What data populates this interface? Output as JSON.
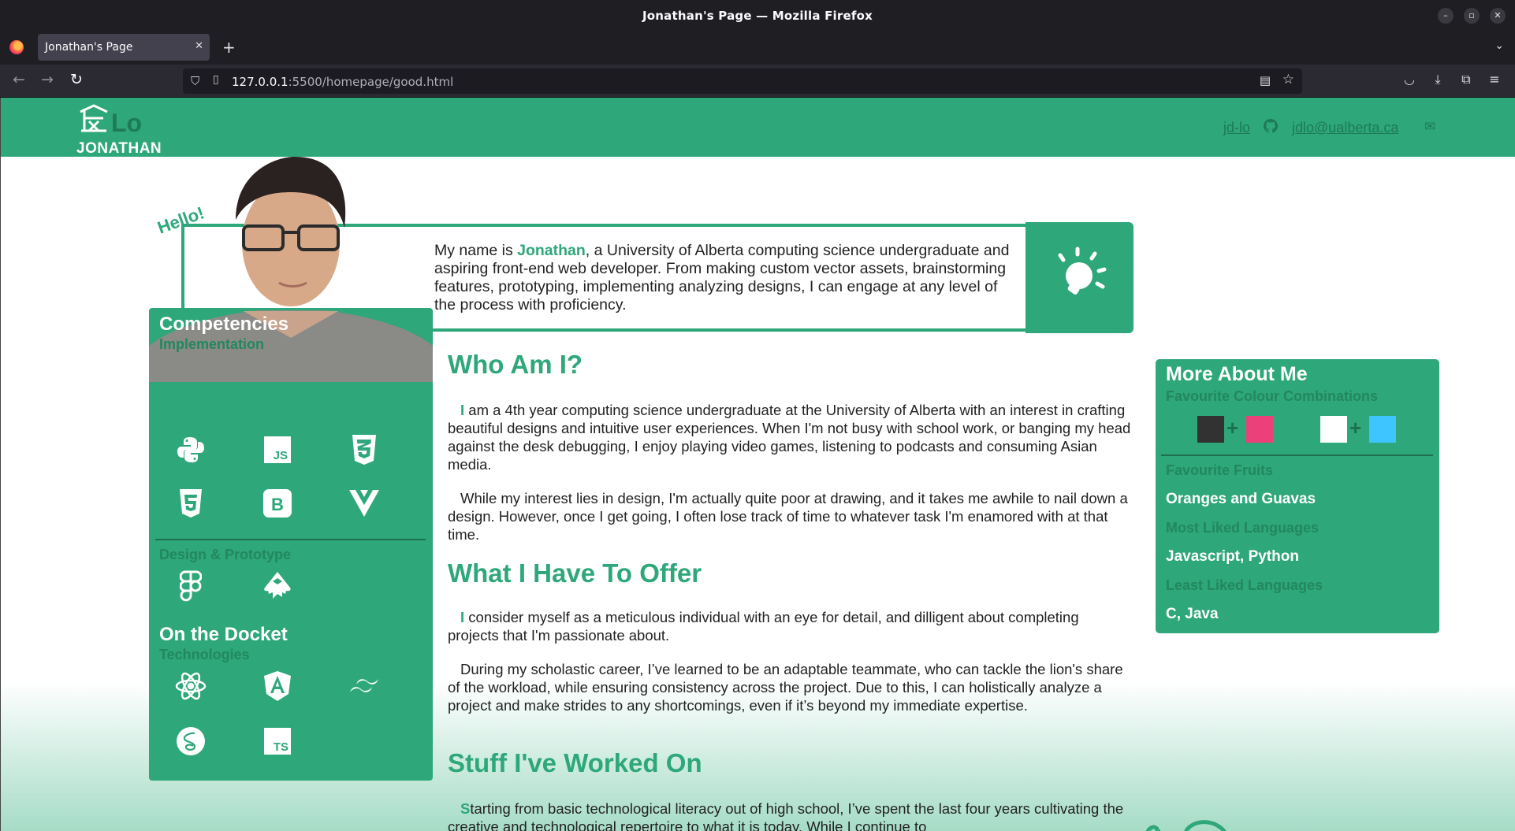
{
  "window": {
    "title": "Jonathan's Page — Mozilla Firefox"
  },
  "tab": {
    "title": "Jonathan's Page"
  },
  "urlbar": {
    "host": "127.0.0.1",
    "rest": ":5500/homepage/good.html"
  },
  "header": {
    "logo_text": "Lo",
    "logo_name": "JONATHAN",
    "github_label": "jd-lo",
    "email_label": "jdlo@ualberta.ca"
  },
  "intro": {
    "hello": "Hello!",
    "prefix": "My name is ",
    "name": "Jonathan",
    "rest": ", a University of Alberta computing science undergraduate and aspiring front-end web developer. From making custom vector assets, brainstorming features, prototyping, implementing analyzing designs, I can engage at any level of the process with proficiency."
  },
  "sidebar": {
    "competencies_title": "Competencies",
    "implementation_label": "Implementation",
    "implementation_icons": [
      "python-icon",
      "javascript-icon",
      "css3-icon",
      "html5-icon",
      "bootstrap-icon",
      "vue-icon"
    ],
    "design_label": "Design & Prototype",
    "design_icons": [
      "figma-icon",
      "inkscape-icon"
    ],
    "docket_title": "On the Docket",
    "technologies_label": "Technologies",
    "technologies_icons": [
      "react-icon",
      "angular-icon",
      "tailwind-icon",
      "sass-icon",
      "typescript-icon"
    ]
  },
  "main": {
    "who_title": "Who Am I?",
    "who_p1_first": "I",
    "who_p1_rest": " am a 4th year computing science undergraduate at the University of Alberta with an interest in crafting beautiful designs and intuitive user experiences. When I'm not busy with school work, or banging my head against the desk debugging, I enjoy playing video games, listening to podcasts and consuming Asian media.",
    "who_p2": "While my interest lies in design, I'm actually quite poor at drawing, and it takes me awhile to nail down a design. However, once I get going, I often lose track of time to whatever task I'm enamored with at that time.",
    "offer_title": "What I Have To Offer",
    "offer_p1_first": "I",
    "offer_p1_rest": " consider myself as a meticulous individual with an eye for detail, and dilligent about completing projects that I'm passionate about.",
    "offer_p2": "During my scholastic career, I’ve learned to be an adaptable teammate, who can tackle the lion's share of the workload, while ensuring consistency across the project. Due to this, I can holistically analyze a project and make strides to any shortcomings, even if it’s beyond my immediate expertise.",
    "stuff_title": "Stuff I've Worked On",
    "stuff_p1_first": "S",
    "stuff_p1_rest": "tarting from basic technological literacy out of high school, I’ve spent the last four years cultivating the creative and technological repertoire to what it is today. While I continue to"
  },
  "more": {
    "title": "More About Me",
    "colour_label": "Favourite Colour Combinations",
    "combos": [
      {
        "a": "#323232",
        "b": "#ec407a"
      },
      {
        "a": "#ffffff",
        "b": "#3ec5ff"
      }
    ],
    "plus": "+",
    "fruits_label": "Favourite Fruits",
    "fruits_value": "Oranges and Guavas",
    "liked_label": "Most Liked Languages",
    "liked_value": "Javascript, Python",
    "least_label": "Least Liked Languages",
    "least_value": "C, Java"
  },
  "colors": {
    "brand": "#2ea77a",
    "brand_dark": "#1e7a58"
  }
}
